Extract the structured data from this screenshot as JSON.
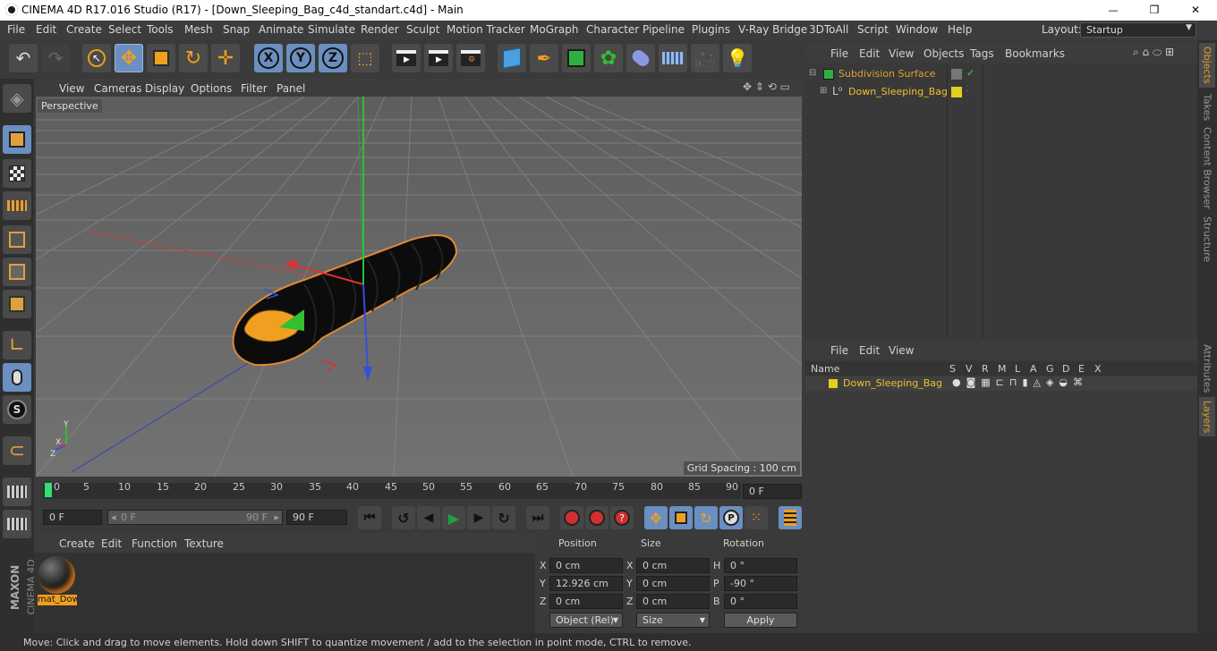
{
  "window": {
    "title": "CINEMA 4D R17.016 Studio (R17) - [Down_Sleeping_Bag_c4d_standart.c4d] - Main",
    "minimize": "—",
    "maximize": "❐",
    "close": "✕"
  },
  "menu": [
    "File",
    "Edit",
    "Create",
    "Select",
    "Tools",
    "Mesh",
    "Snap",
    "Animate",
    "Simulate",
    "Render",
    "Sculpt",
    "Motion Tracker",
    "MoGraph",
    "Character",
    "Pipeline",
    "Plugins",
    "V-Ray Bridge",
    "3DToAll",
    "Script",
    "Window",
    "Help"
  ],
  "layout": {
    "label": "Layout:",
    "value": "Startup"
  },
  "toolbar": {
    "x": "X",
    "y": "Y",
    "z": "Z"
  },
  "viewport": {
    "menu": [
      "View",
      "Cameras",
      "Display",
      "Options",
      "Filter",
      "Panel"
    ],
    "label": "Perspective",
    "grid_spacing": "Grid Spacing : 100 cm",
    "axis_x": "X",
    "axis_y": "Y",
    "axis_z": "Z"
  },
  "timeline": {
    "ticks": [
      "0",
      "5",
      "10",
      "15",
      "20",
      "25",
      "30",
      "35",
      "40",
      "45",
      "50",
      "55",
      "60",
      "65",
      "70",
      "75",
      "80",
      "85",
      "90"
    ],
    "current": "0 F"
  },
  "transport": {
    "start": "0 F",
    "slider_left": "0 F",
    "slider_right": "90 F",
    "end": "90 F"
  },
  "materials": {
    "menu": [
      "Create",
      "Edit",
      "Function",
      "Texture"
    ],
    "items": [
      {
        "name": "mat_Dow"
      }
    ]
  },
  "coordinates": {
    "headers": [
      "Position",
      "Size",
      "Rotation"
    ],
    "rows": [
      {
        "pos_axis": "X",
        "pos": "0 cm",
        "size_axis": "X",
        "size": "0 cm",
        "rot_axis": "H",
        "rot": "0 °"
      },
      {
        "pos_axis": "Y",
        "pos": "12.926 cm",
        "size_axis": "Y",
        "size": "0 cm",
        "rot_axis": "P",
        "rot": "-90 °"
      },
      {
        "pos_axis": "Z",
        "pos": "0 cm",
        "size_axis": "Z",
        "size": "0 cm",
        "rot_axis": "B",
        "rot": "0 °"
      }
    ],
    "mode": "Object (Rel)",
    "size_mode": "Size",
    "apply": "Apply"
  },
  "objects": {
    "menu": [
      "File",
      "Edit",
      "View",
      "Objects",
      "Tags",
      "Bookmarks"
    ],
    "items": [
      {
        "name": "Subdivision Surface"
      },
      {
        "name": "Down_Sleeping_Bag"
      }
    ]
  },
  "layers": {
    "menu": [
      "File",
      "Edit",
      "View"
    ],
    "columns": [
      "Name",
      "S",
      "V",
      "R",
      "M",
      "L",
      "A",
      "G",
      "D",
      "E",
      "X"
    ],
    "items": [
      {
        "name": "Down_Sleeping_Bag"
      }
    ]
  },
  "right_tabs": [
    "Objects",
    "Takes",
    "Content Browser",
    "Structure",
    "Attributes",
    "Layers"
  ],
  "brand": {
    "maxon": "MAXON",
    "product": "CINEMA 4D"
  },
  "status": "Move: Click and drag to move elements. Hold down SHIFT to quantize movement / add to the selection in point mode, CTRL to remove.",
  "colors": {
    "accent": "#6a8fc0",
    "selection_orange": "#f0a830",
    "object_yellow": "#e0d020",
    "axis_red": "#e03030",
    "axis_green": "#30c030",
    "axis_blue": "#3050e0"
  }
}
